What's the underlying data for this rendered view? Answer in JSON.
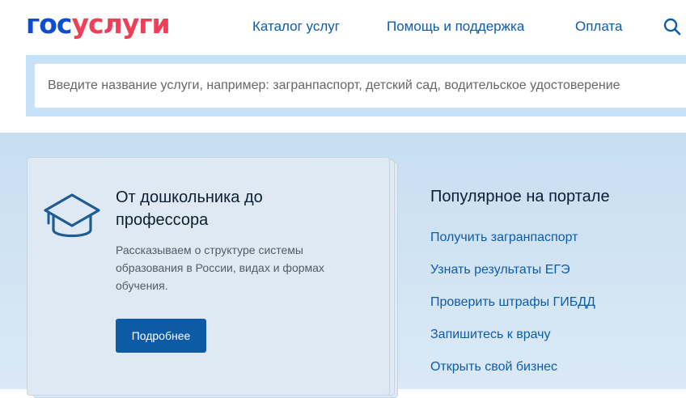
{
  "header": {
    "logo_part1": "гос",
    "logo_part2": "услуги",
    "nav": [
      "Каталог услуг",
      "Помощь и поддержка",
      "Оплата"
    ],
    "search_icon": "search-icon"
  },
  "search": {
    "placeholder": "Введите название услуги, например: загранпаспорт, детский сад, водительское удостоверение"
  },
  "promo": {
    "icon": "graduation-cap-icon",
    "title": "От дошкольника до профессора",
    "text": "Рассказываем о структуре системы образования в России, видах и формах обучения.",
    "button": "Подробнее"
  },
  "popular": {
    "title": "Популярное на портале",
    "items": [
      "Получить загранпаспорт",
      "Узнать результаты ЕГЭ",
      "Проверить штрафы ГИБДД",
      "Запишитесь к врачу",
      "Открыть свой бизнес"
    ]
  },
  "colors": {
    "logo_blue": "#0d4cd3",
    "logo_red": "#ee3f58",
    "link": "#0d5cab",
    "button": "#0d5aa7",
    "band": "#c6e2f8"
  }
}
